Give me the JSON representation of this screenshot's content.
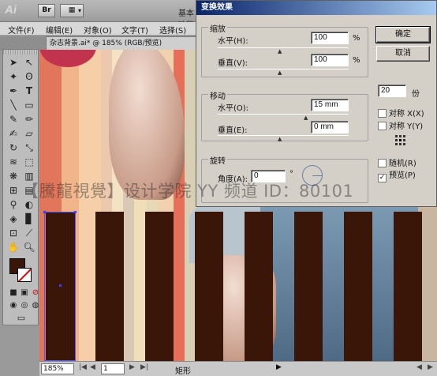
{
  "app": {
    "logo": "Ai",
    "bridge_label": "Br",
    "workspace_label": "基本功能"
  },
  "menu": {
    "items": [
      "文件(F)",
      "编辑(E)",
      "对象(O)",
      "文字(T)",
      "选择(S)"
    ]
  },
  "document": {
    "tab_title": "杂志背景.ai* @ 185% (RGB/预览)",
    "zoom": "185%",
    "page": "1",
    "status_tool": "矩形"
  },
  "dialog": {
    "title": "变换效果",
    "scale": {
      "title": "缩放",
      "horizontal_label": "水平(H):",
      "horizontal_value": "100",
      "vertical_label": "垂直(V):",
      "vertical_value": "100",
      "unit": "%"
    },
    "move": {
      "title": "移动",
      "horizontal_label": "水平(O):",
      "horizontal_value": "15 mm",
      "vertical_label": "垂直(E):",
      "vertical_value": "0 mm"
    },
    "rotate": {
      "title": "旋转",
      "angle_label": "角度(A):",
      "angle_value": "0",
      "angle_unit": "°"
    },
    "copies_value": "20",
    "copies_label": "份",
    "ok_label": "确定",
    "cancel_label": "取消",
    "reflect_x_label": "对称 X(X)",
    "reflect_y_label": "对称 Y(Y)",
    "random_label": "随机(R)",
    "preview_label": "预览(P)",
    "preview_checked": "✓"
  },
  "watermark": "【騰龍視覺】设计学院  YY 频道 ID：80101",
  "colors": {
    "fill": "#3a1608",
    "accent": "#0a246a"
  }
}
